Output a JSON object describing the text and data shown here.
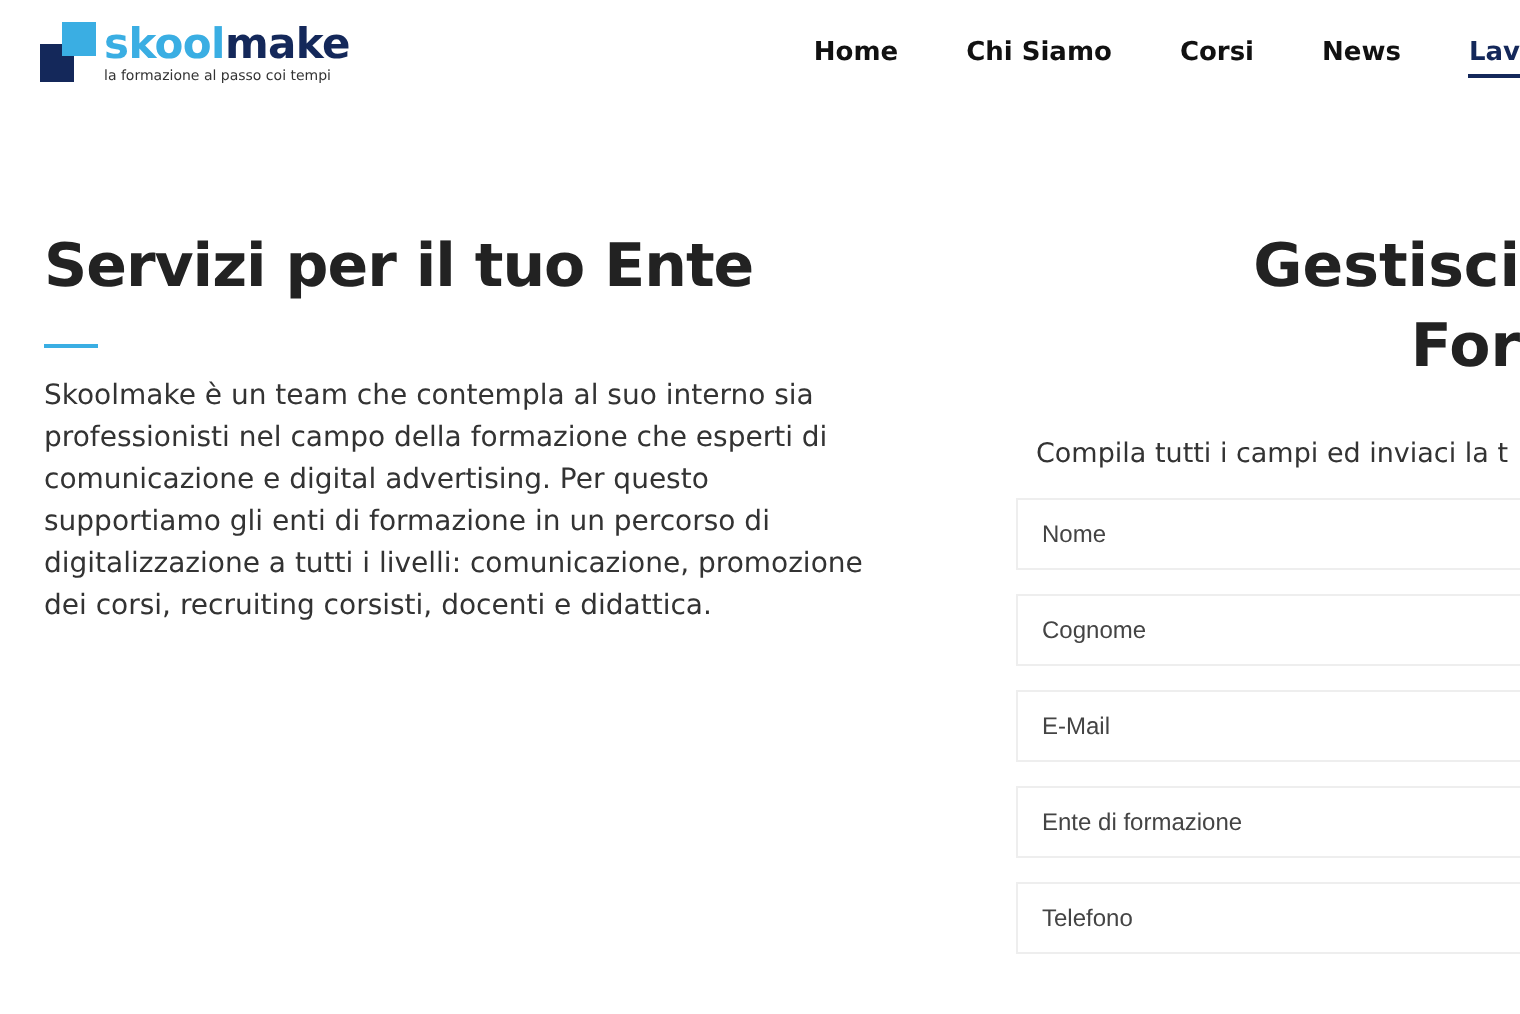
{
  "header": {
    "logo": {
      "brand_prefix": "skool",
      "brand_suffix": "make",
      "tagline": "la formazione al passo coi tempi"
    },
    "nav": [
      {
        "label": "Home",
        "selected": false
      },
      {
        "label": "Chi Siamo",
        "selected": false
      },
      {
        "label": "Corsi",
        "selected": false
      },
      {
        "label": "News",
        "selected": false
      },
      {
        "label": "Lav",
        "selected": true
      }
    ]
  },
  "services": {
    "title": "Servizi per il tuo Ente",
    "text": "Skoolmake è un team che contempla al suo interno sia professionisti nel campo della formazione che esperti di comunicazione e digital advertising. Per questo supportiamo gli enti di formazione in un percorso di digitalizzazione a tutti i livelli: comunicazione, promozione dei corsi, recruiting corsisti, docenti e didattica."
  },
  "form": {
    "title_lines": [
      "Gestisci",
      "For"
    ],
    "intro": "Compila tutti i campi ed inviaci la t",
    "fields": [
      {
        "placeholder": "Nome"
      },
      {
        "placeholder": "Cognome"
      },
      {
        "placeholder": "E-Mail"
      },
      {
        "placeholder": "Ente di formazione"
      },
      {
        "placeholder": "Telefono"
      }
    ]
  }
}
